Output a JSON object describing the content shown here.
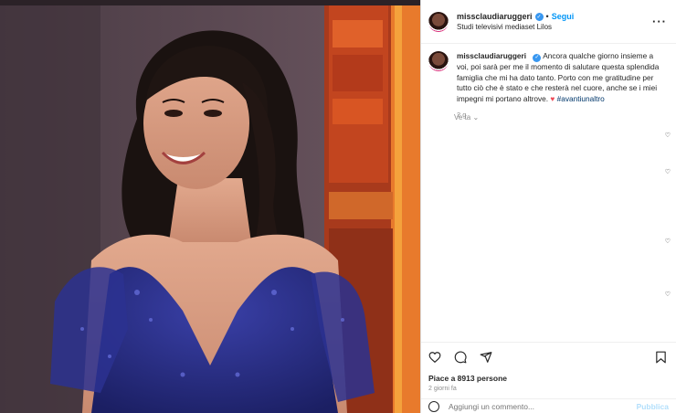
{
  "post": {
    "username": "missclaudiaruggeri",
    "follow_label": "Segui",
    "location": "Studi televisivi mediaset Lilos",
    "more_icon": "more-horizontal-icon",
    "caption": {
      "username": "missclaudiaruggeri",
      "text": "Ancora qualche giorno insieme a voi, poi sarà per me il momento di salutare questa splendida famiglia che mi ha dato tanto. Porto con me gratitudine per tutto ciò che è stato e che resterà nel cuore, anche se i miei impegni mi portano altrove.",
      "emoji": "♥",
      "hashtag": "#avantiunaltro",
      "age": "2 g"
    },
    "translate_label": "Ve ta",
    "likes_text": "Piace a 8913 persone",
    "date_text": "2 giorni fa",
    "comment_placeholder": "Aggiungi un commento...",
    "publish_label": "Pubblica"
  },
  "colors": {
    "link_blue": "#0095f6",
    "verified_blue": "#3897f0",
    "dress": "#2a2f86",
    "studio_orange": "#d9561f"
  },
  "icons": [
    "like-heart-icon",
    "comment-icon",
    "share-icon",
    "save-bookmark-icon",
    "emoji-icon",
    "verified-icon"
  ]
}
